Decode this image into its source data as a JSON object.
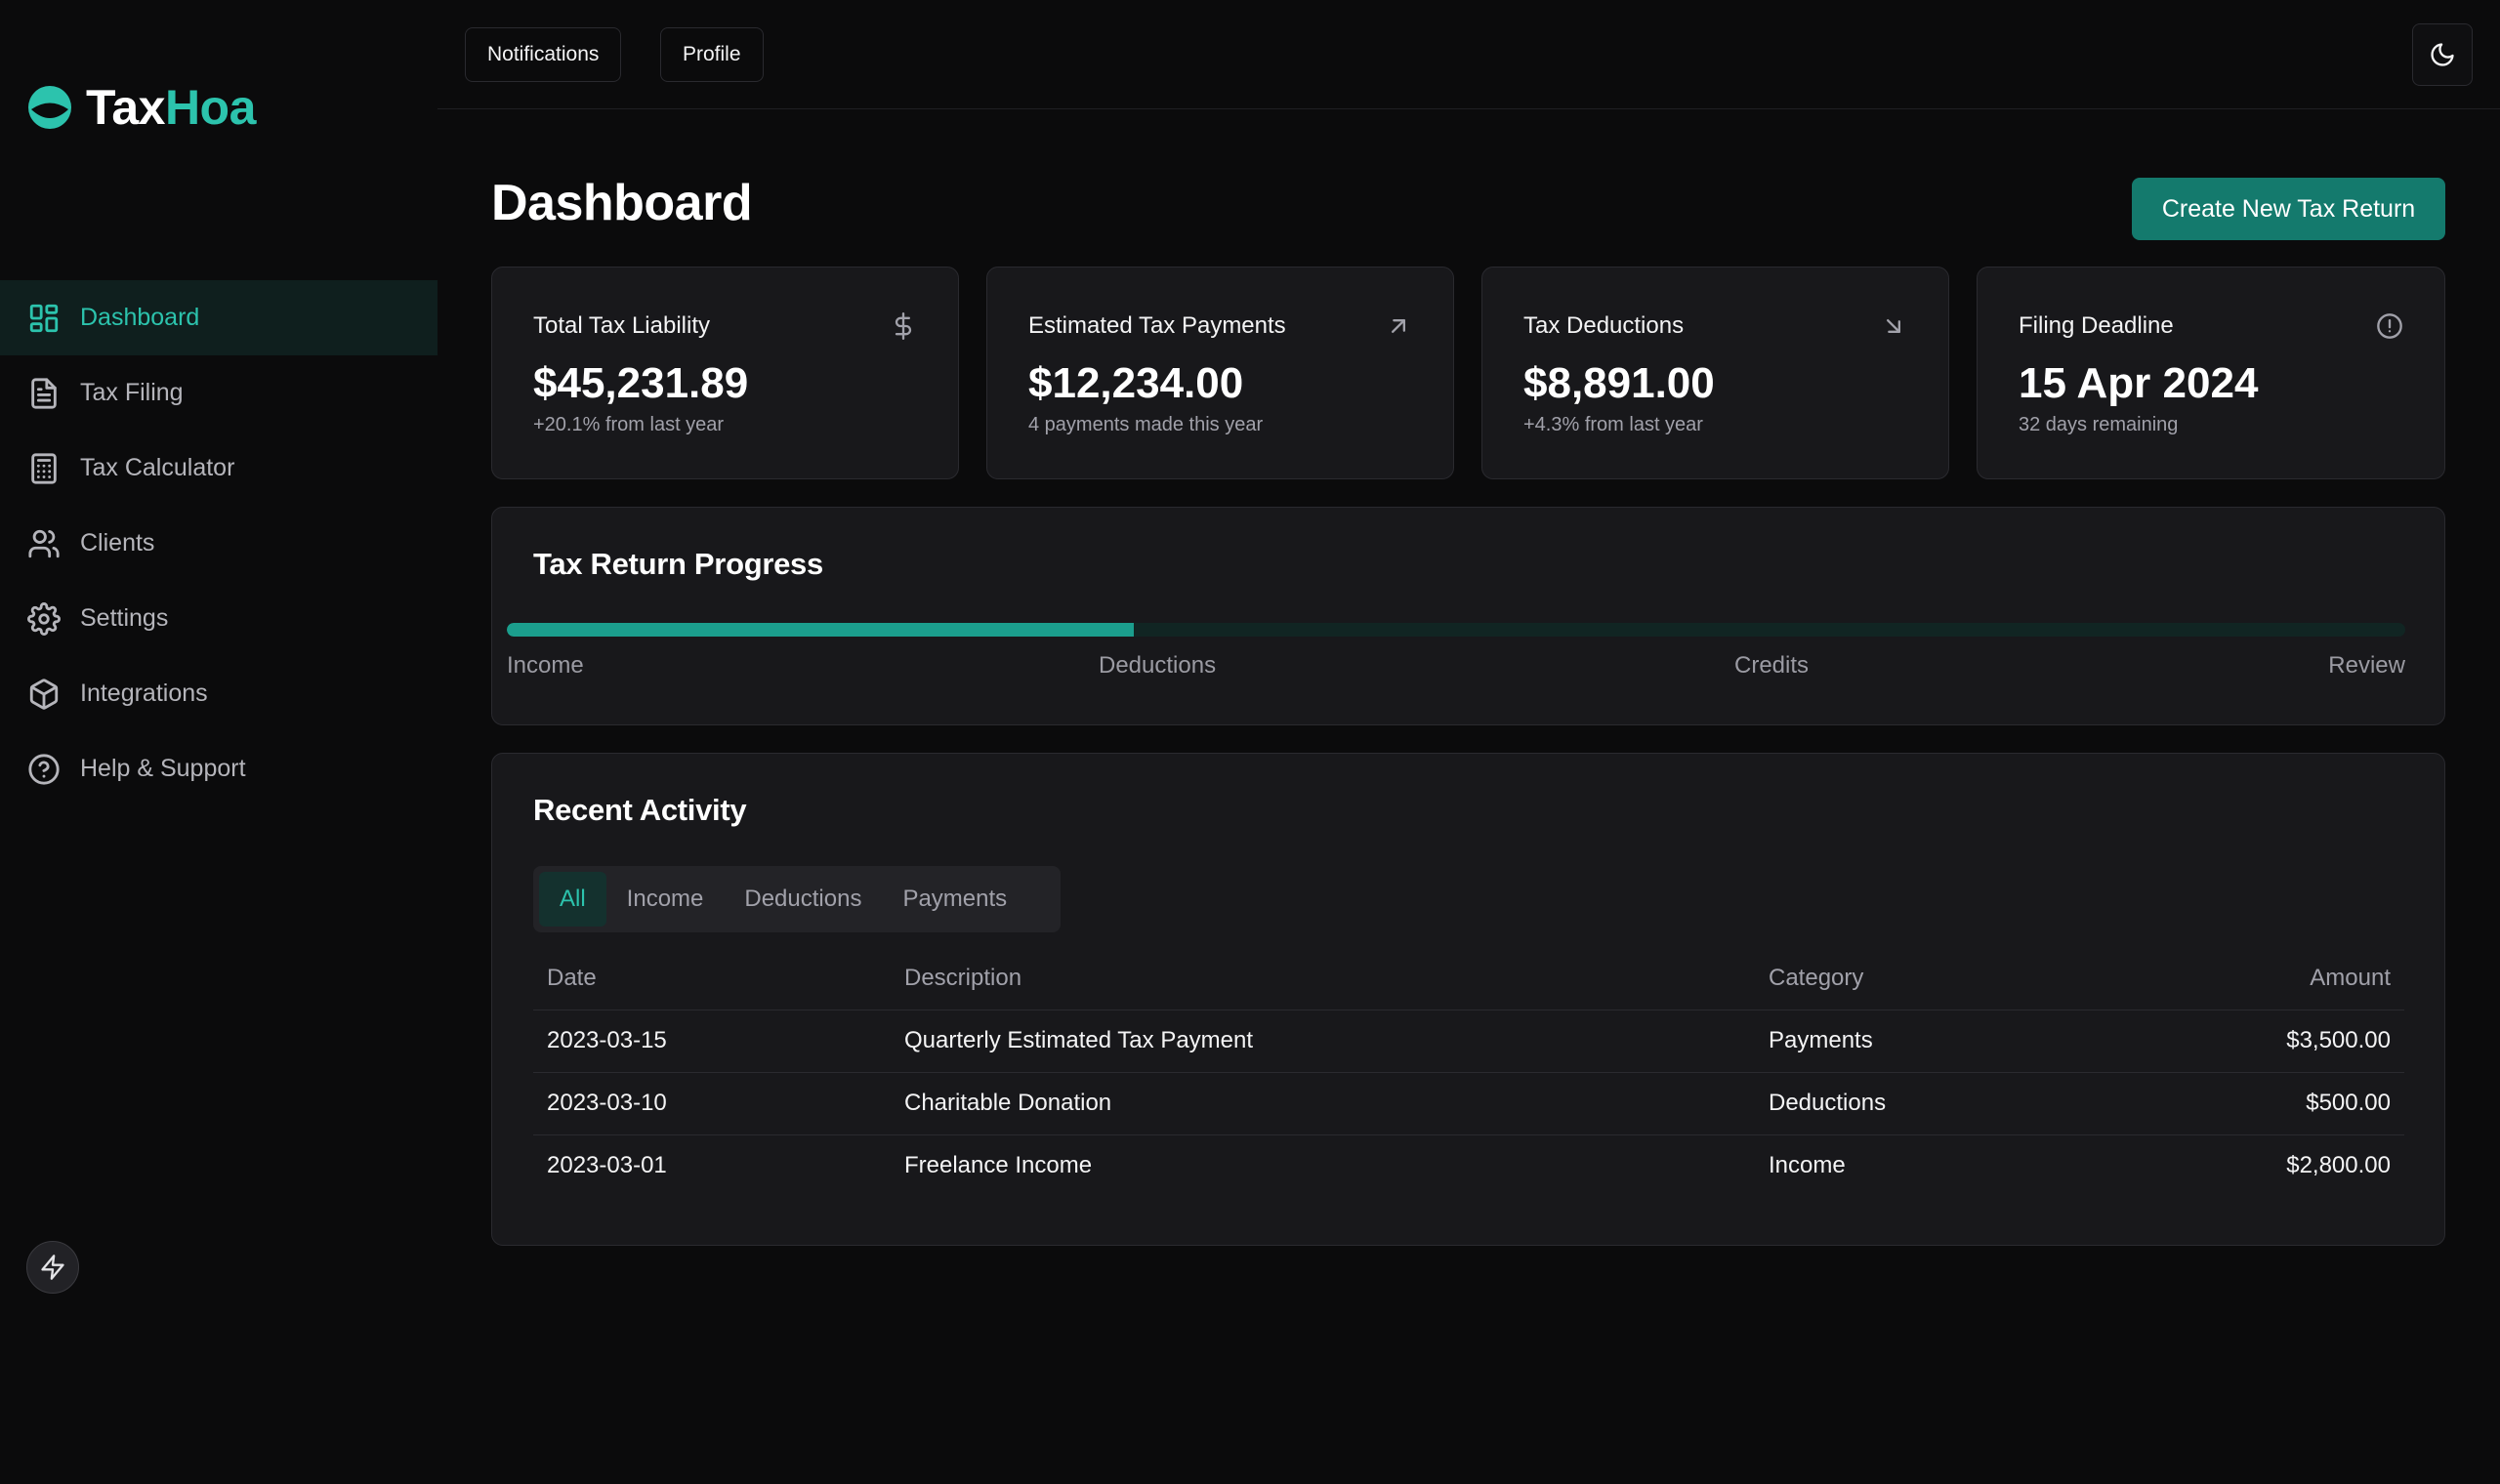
{
  "brand": {
    "name_part1": "Tax",
    "name_part2": "Hoa",
    "accent": "#2cc3ad"
  },
  "topbar": {
    "notifications_label": "Notifications",
    "profile_label": "Profile",
    "theme_icon": "moon-icon"
  },
  "sidebar": {
    "items": [
      {
        "label": "Dashboard",
        "icon": "layout-grid-icon",
        "active": true
      },
      {
        "label": "Tax Filing",
        "icon": "file-text-icon",
        "active": false
      },
      {
        "label": "Tax Calculator",
        "icon": "calculator-icon",
        "active": false
      },
      {
        "label": "Clients",
        "icon": "users-icon",
        "active": false
      },
      {
        "label": "Settings",
        "icon": "gear-icon",
        "active": false
      },
      {
        "label": "Integrations",
        "icon": "package-icon",
        "active": false
      },
      {
        "label": "Help & Support",
        "icon": "help-circle-icon",
        "active": false
      }
    ],
    "footer_icon": "bolt-icon"
  },
  "page": {
    "title": "Dashboard",
    "primary_action": "Create New Tax Return"
  },
  "stats": [
    {
      "label": "Total Tax Liability",
      "value": "$45,231.89",
      "sub": "+20.1% from last year",
      "icon": "dollar-icon"
    },
    {
      "label": "Estimated Tax Payments",
      "value": "$12,234.00",
      "sub": "4 payments made this year",
      "icon": "arrow-up-right-icon"
    },
    {
      "label": "Tax Deductions",
      "value": "$8,891.00",
      "sub": "+4.3% from last year",
      "icon": "arrow-down-right-icon"
    },
    {
      "label": "Filing Deadline",
      "value": "15 Apr 2024",
      "sub": "32 days remaining",
      "icon": "alert-circle-icon"
    }
  ],
  "progress": {
    "title": "Tax Return Progress",
    "percent": 33,
    "steps": [
      "Income",
      "Deductions",
      "Credits",
      "Review"
    ]
  },
  "activity": {
    "title": "Recent Activity",
    "tabs": [
      "All",
      "Income",
      "Deductions",
      "Payments"
    ],
    "active_tab": "All",
    "columns": [
      "Date",
      "Description",
      "Category",
      "Amount"
    ],
    "rows": [
      [
        "2023-03-15",
        "Quarterly Estimated Tax Payment",
        "Payments",
        "$3,500.00"
      ],
      [
        "2023-03-10",
        "Charitable Donation",
        "Deductions",
        "$500.00"
      ],
      [
        "2023-03-01",
        "Freelance Income",
        "Income",
        "$2,800.00"
      ]
    ]
  }
}
